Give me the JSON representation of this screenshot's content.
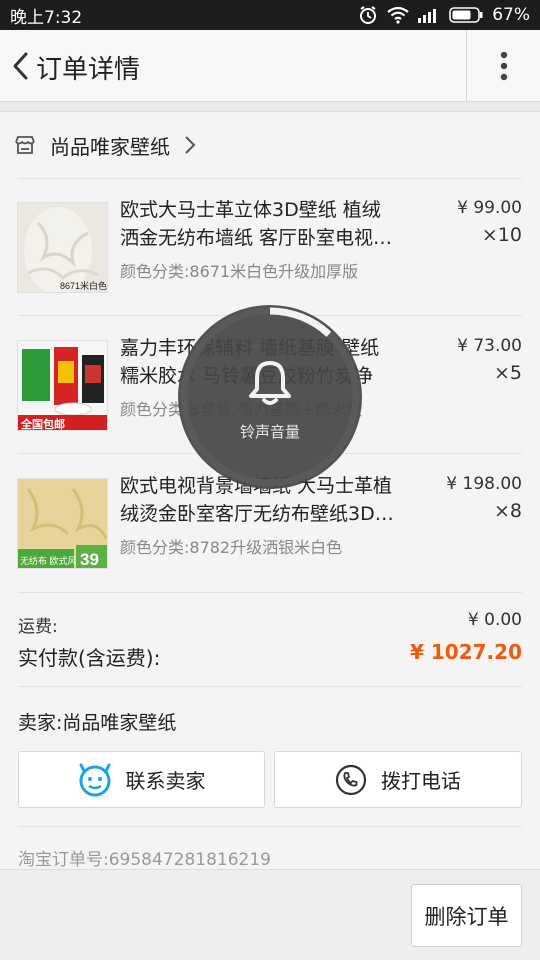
{
  "status_bar": {
    "time": "晚上7:32",
    "battery": "67%"
  },
  "header": {
    "title": "订单详情"
  },
  "shop": {
    "name": "尚品唯家壁纸"
  },
  "items": [
    {
      "line1": "欧式大马士革立体3D壁纸 植绒",
      "line2": "洒金无纺布墙纸 客厅卧室电视…",
      "sku": "颜色分类:8671米白色升级加厚版",
      "price": "¥ 99.00",
      "qty": "×10",
      "thumb_caption": "8671米白色"
    },
    {
      "line1": "嘉力丰环保辅料 墙纸基膜 壁纸",
      "line2": "糯米胶水 马铃薯豆胶粉竹炭净",
      "sku": "颜色分类:8套装:强力基膜+糯米胶",
      "price": "¥ 73.00",
      "qty": "×5",
      "thumb_caption": "全国包邮"
    },
    {
      "line1": "欧式电视背景墙墙纸 大马士革植",
      "line2": "绒烫金卧室客厅无纺布壁纸3D…",
      "sku": "颜色分类:8782升级洒银米白色",
      "price": "¥ 198.00",
      "qty": "×8",
      "thumb_caption": "无纺布 欧式风格",
      "thumb_badge": "39"
    }
  ],
  "summary": {
    "shipping_label": "运费:",
    "shipping_value": "¥ 0.00",
    "paid_label": "实付款(含运费):",
    "paid_value": "¥ 1027.20"
  },
  "seller": {
    "label": "卖家:尚品唯家壁纸"
  },
  "buttons": {
    "contact": "联系卖家",
    "call": "拨打电话",
    "delete": "删除订单"
  },
  "order": {
    "number_label": "淘宝订单号:695847281816219"
  },
  "overlay": {
    "label": "铃声音量",
    "level": 0.12
  },
  "colors": {
    "accent": "#f05a0a",
    "contact_icon": "#1aa3e8"
  }
}
